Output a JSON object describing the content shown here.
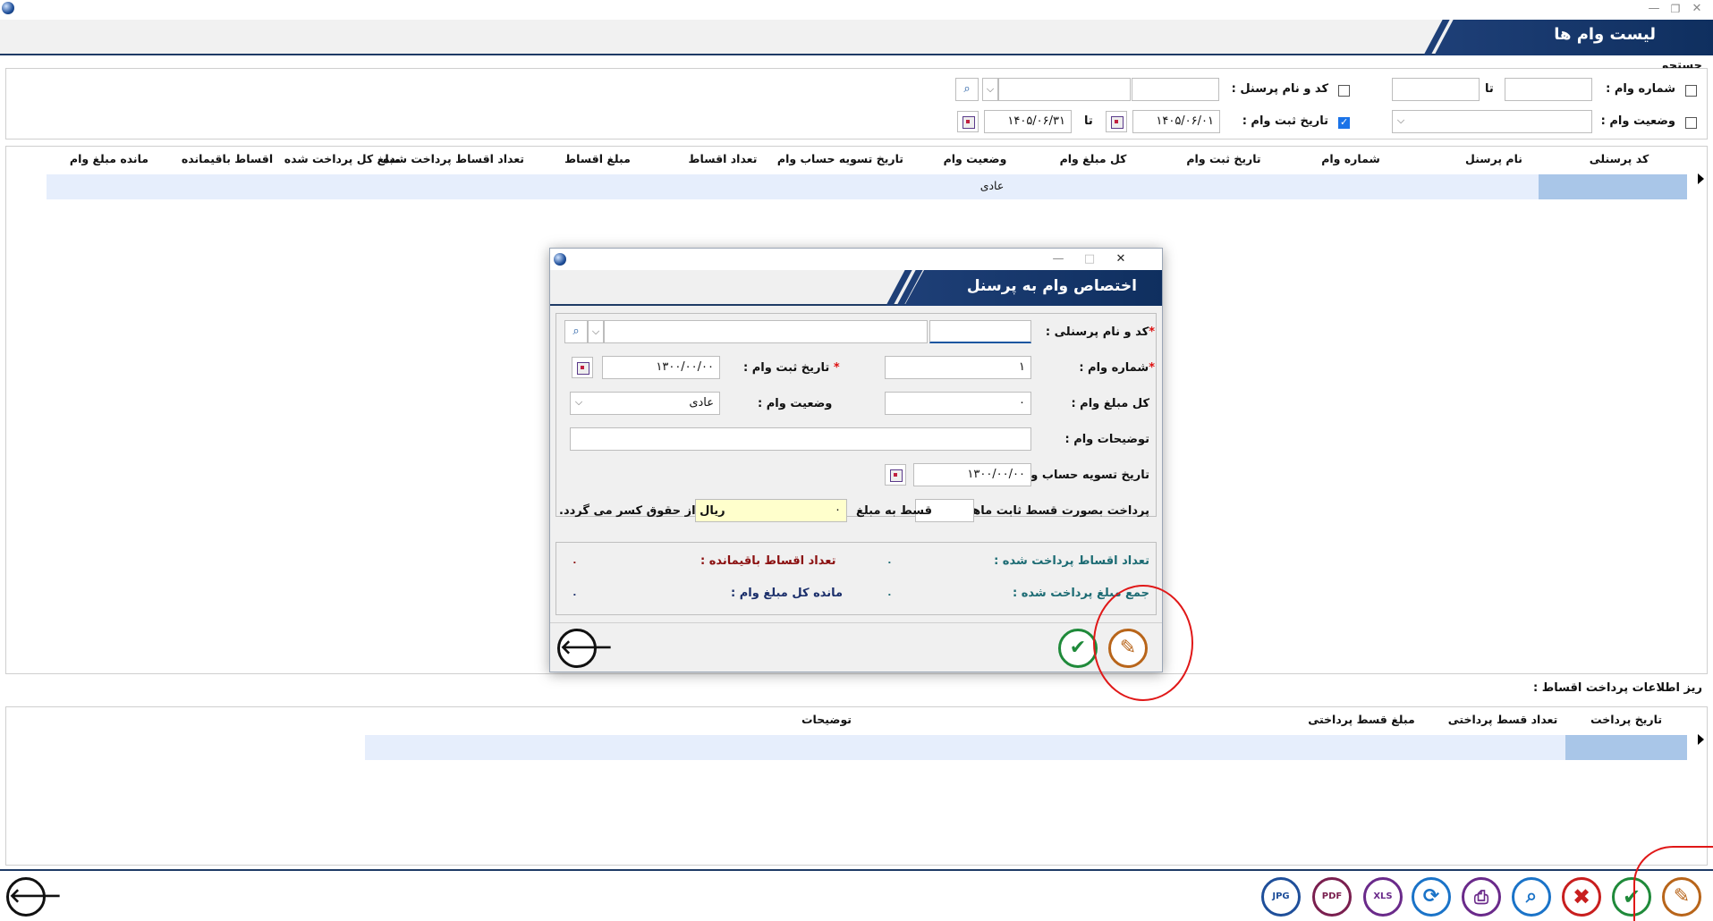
{
  "window": {
    "title": "لیست وام ها",
    "minimize_glyph": "—",
    "restore_glyph": "❐",
    "close_glyph": "✕"
  },
  "search": {
    "section_label": "جستجو",
    "loan_number_label": "شماره وام :",
    "to_label": "تا",
    "personnel_label": "کد و نام پرسنل :",
    "loan_status_label": "وضعیت وام :",
    "register_date_label": "تاریخ ثبت وام :",
    "register_date_checked": true,
    "date_from": "۱۴۰۵/۰۶/۰۱",
    "date_to_label": "تا",
    "date_to": "۱۴۰۵/۰۶/۳۱"
  },
  "loans_grid": {
    "columns": [
      "کد پرسنلی",
      "نام پرسنل",
      "شماره وام",
      "تاریخ ثبت وام",
      "کل مبلغ وام",
      "وضعیت وام",
      "تاریخ تسویه حساب وام",
      "تعداد اقساط",
      "مبلغ اقساط",
      "تعداد اقساط پرداخت شده",
      "مبلغ کل پرداخت شده",
      "اقساط باقیمانده",
      "مانده مبلغ وام"
    ],
    "rows": [
      {
        "status": "عادی"
      }
    ]
  },
  "installments": {
    "section_label": "ریز اطلاعات پرداخت اقساط :",
    "columns": [
      "تاریخ پرداخت",
      "تعداد قسط پرداختی",
      "مبلغ قسط پرداختی",
      "توضیحات"
    ]
  },
  "dialog": {
    "title": "اختصاص وام به پرسنل",
    "minimize_glyph": "—",
    "maximize_glyph": "□",
    "close_glyph": "✕",
    "personnel_label": "کد و نام پرسنلی :",
    "personnel_code": "",
    "loan_number_label": "شماره وام :",
    "loan_number": "۱",
    "register_date_label": "تاریخ ثبت وام :",
    "register_date": "۱۳۰۰/۰۰/۰۰",
    "total_amount_label": "کل مبلغ وام :",
    "total_amount": "۰",
    "status_label": "وضعیت وام :",
    "status_value": "عادی",
    "description_label": "توضیحات وام :",
    "description": "",
    "settlement_date_label": "تاریخ تسویه حساب وام :",
    "settlement_date": "۱۳۰۰/۰۰/۰۰",
    "payment_prefix": "پرداخت بصورت قسط ثابت ماهیانه در",
    "installment_count": "",
    "installment_amount_label": "قسط به مبلغ",
    "installment_amount": "۰",
    "payment_suffix": "ریال از حقوق کسر می گردد.",
    "paid_count_label": "تعداد اقساط پرداخت شده :",
    "paid_count": "۰",
    "remaining_count_label": "تعداد اقساط باقیمانده :",
    "remaining_count": "۰",
    "paid_sum_label": "جمع مبلغ پرداخت شده :",
    "paid_sum": "۰",
    "remaining_amount_label": "مانده کل مبلغ وام :",
    "remaining_amount": "۰"
  },
  "toolbar": {
    "jpg_label": "JPG",
    "pdf_label": "PDF",
    "xls_label": "XLS",
    "accent_colors": {
      "jpg": "#1f4f9a",
      "pdf": "#7a1f4f",
      "xls": "#6a2a8a",
      "refresh": "#1a73c8",
      "print": "#6a2a8a",
      "search": "#1a73c8",
      "delete": "#c81e1e",
      "confirm": "#1f8a3a",
      "edit": "#b8651a"
    }
  },
  "icons": [
    "app-logo-icon",
    "search-icon",
    "calendar-icon",
    "chevron-down-icon",
    "back-arrow-icon",
    "confirm-check-icon",
    "edit-pencil-icon",
    "jpg-export-icon",
    "pdf-export-icon",
    "xls-export-icon",
    "refresh-icon",
    "print-icon",
    "search-zoom-icon",
    "delete-x-icon",
    "row-indicator-icon"
  ]
}
